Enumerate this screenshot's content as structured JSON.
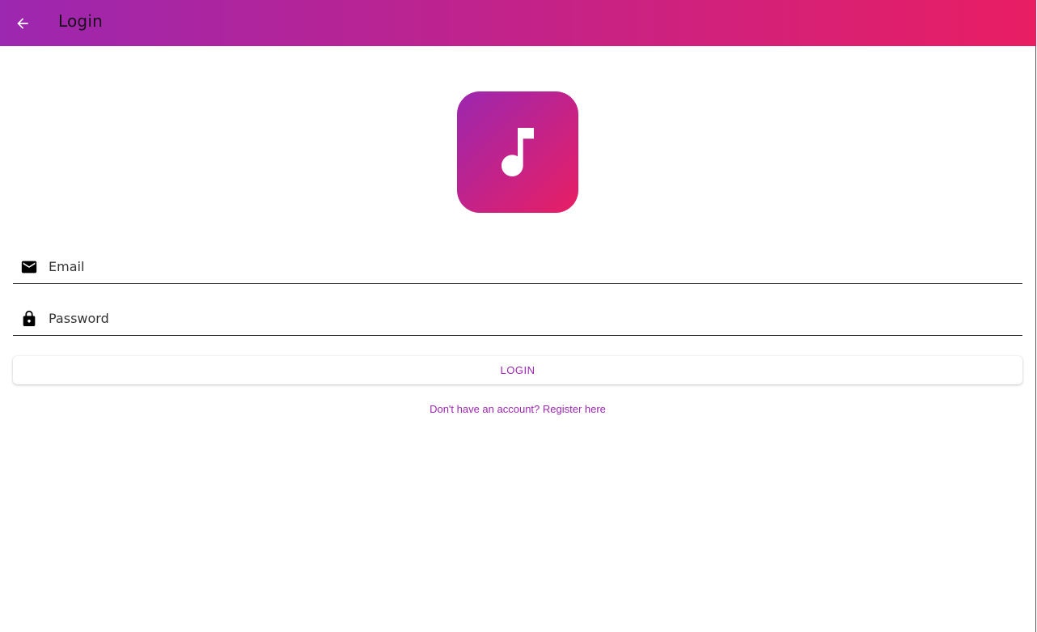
{
  "app_bar": {
    "title": "Login",
    "back_icon": "arrow-left-icon",
    "gradient": [
      "#9c27b0",
      "#e91e63"
    ]
  },
  "logo": {
    "icon": "music-note-icon",
    "gradient": [
      "#9c27b0",
      "#e91e63"
    ]
  },
  "form": {
    "email": {
      "icon": "mail-icon",
      "placeholder": "Email",
      "value": ""
    },
    "password": {
      "icon": "lock-icon",
      "placeholder": "Password",
      "value": ""
    },
    "login_label": "LOGIN",
    "register_link": "Don't have an account? Register here"
  },
  "colors": {
    "accent": "#9c27b0",
    "accent_end": "#e91e63"
  }
}
